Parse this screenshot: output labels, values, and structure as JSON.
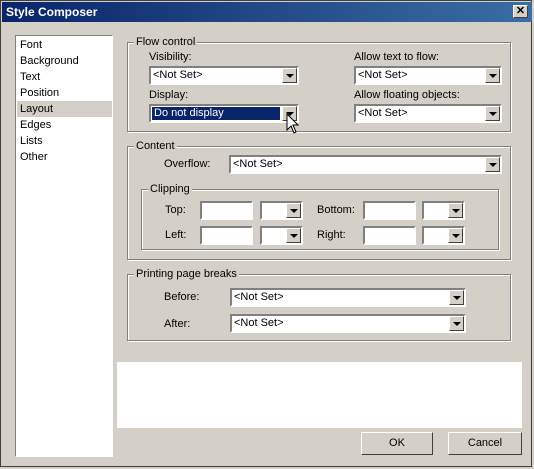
{
  "window": {
    "title": "Style Composer"
  },
  "categories": [
    {
      "label": "Font",
      "selected": false
    },
    {
      "label": "Background",
      "selected": false
    },
    {
      "label": "Text",
      "selected": false
    },
    {
      "label": "Position",
      "selected": false
    },
    {
      "label": "Layout",
      "selected": true
    },
    {
      "label": "Edges",
      "selected": false
    },
    {
      "label": "Lists",
      "selected": false
    },
    {
      "label": "Other",
      "selected": false
    }
  ],
  "flow_control": {
    "legend": "Flow control",
    "visibility_label": "Visibility:",
    "visibility_value": "<Not Set>",
    "display_label": "Display:",
    "display_value": "Do not display",
    "allow_text_label": "Allow text to flow:",
    "allow_text_value": "<Not Set>",
    "allow_floating_label": "Allow floating objects:",
    "allow_floating_value": "<Not Set>"
  },
  "content": {
    "legend": "Content",
    "overflow_label": "Overflow:",
    "overflow_value": "<Not Set>",
    "clipping": {
      "legend": "Clipping",
      "top_label": "Top:",
      "left_label": "Left:",
      "bottom_label": "Bottom:",
      "right_label": "Right:"
    }
  },
  "page_breaks": {
    "legend": "Printing page breaks",
    "before_label": "Before:",
    "before_value": "<Not Set>",
    "after_label": "After:",
    "after_value": "<Not Set>"
  },
  "buttons": {
    "ok": "OK",
    "cancel": "Cancel"
  }
}
